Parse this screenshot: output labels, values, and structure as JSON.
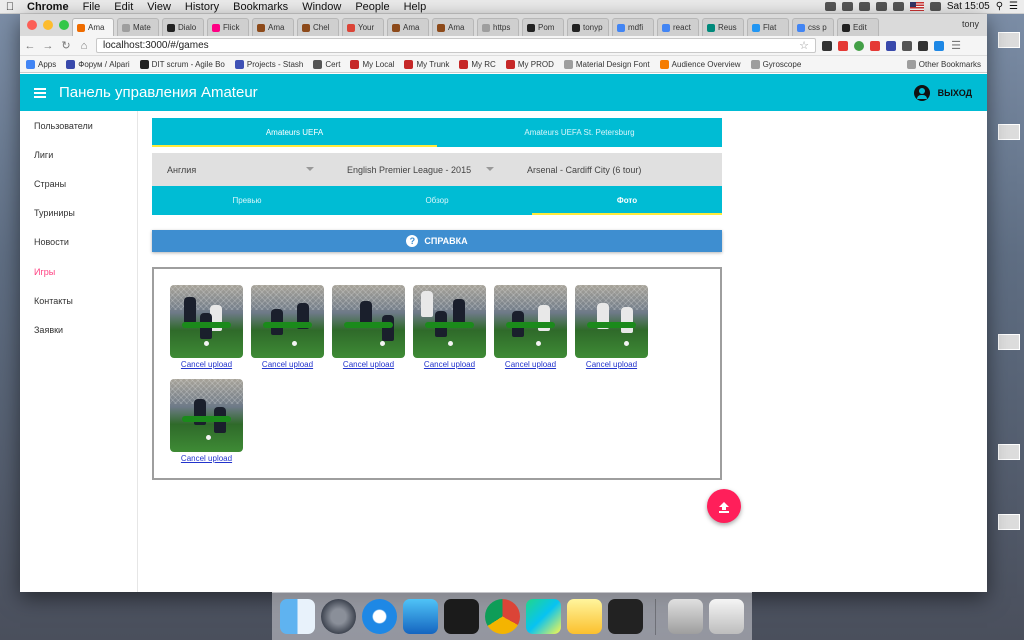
{
  "menubar": {
    "app": "Chrome",
    "items": [
      "File",
      "Edit",
      "View",
      "History",
      "Bookmarks",
      "Window",
      "People",
      "Help"
    ],
    "clock": "Sat 15:05"
  },
  "browser": {
    "tabs": [
      {
        "label": "Ama",
        "color": "#ef6c00",
        "active": true
      },
      {
        "label": "Mate",
        "color": "#9e9e9e"
      },
      {
        "label": "Dialo",
        "color": "#222222"
      },
      {
        "label": "Flick",
        "color": "#ff0084"
      },
      {
        "label": "Ama",
        "color": "#8d4a1a"
      },
      {
        "label": "Chel",
        "color": "#8d4a1a"
      },
      {
        "label": "Your",
        "color": "#db4437"
      },
      {
        "label": "Ama",
        "color": "#8d4a1a"
      },
      {
        "label": "Ama",
        "color": "#8d4a1a"
      },
      {
        "label": "https",
        "color": "#9e9e9e"
      },
      {
        "label": "Pom",
        "color": "#222222"
      },
      {
        "label": "tonyp",
        "color": "#222222"
      },
      {
        "label": "mdfi",
        "color": "#4285f4"
      },
      {
        "label": "react",
        "color": "#4285f4"
      },
      {
        "label": "Reus",
        "color": "#00897b"
      },
      {
        "label": "Flat",
        "color": "#2196f3"
      },
      {
        "label": "css p",
        "color": "#4285f4"
      },
      {
        "label": "Edit",
        "color": "#222222"
      }
    ],
    "profile": "tony",
    "url": "localhost:3000/#/games",
    "bookmarks": [
      {
        "label": "Apps",
        "color": "#4285f4"
      },
      {
        "label": "Форум / Alpari",
        "color": "#3949ab"
      },
      {
        "label": "DIT scrum - Agile Bo",
        "color": "#222222"
      },
      {
        "label": "Projects - Stash",
        "color": "#3f51b5"
      },
      {
        "label": "Cert",
        "color": "#555555"
      },
      {
        "label": "My Local",
        "color": "#c62828"
      },
      {
        "label": "My Trunk",
        "color": "#c62828"
      },
      {
        "label": "My RC",
        "color": "#c62828"
      },
      {
        "label": "My PROD",
        "color": "#c62828"
      },
      {
        "label": "Material Design Font",
        "color": "#9e9e9e"
      },
      {
        "label": "Audience Overview",
        "color": "#f57c00"
      },
      {
        "label": "Gyroscope",
        "color": "#9e9e9e"
      }
    ],
    "other_bookmarks": "Other Bookmarks"
  },
  "app": {
    "title": "Панель управления Amateur",
    "logout": "ВЫХОД",
    "accent": "#00bcd4",
    "sidebar": [
      {
        "label": "Пользователи"
      },
      {
        "label": "Лиги"
      },
      {
        "label": "Страны"
      },
      {
        "label": "Туриниры"
      },
      {
        "label": "Новости"
      },
      {
        "label": "Игры",
        "active": true
      },
      {
        "label": "Контакты"
      },
      {
        "label": "Заявки"
      }
    ],
    "org_tabs": [
      {
        "label": "Amateurs UEFA",
        "active": true
      },
      {
        "label": "Amateurs UEFA St. Petersburg"
      }
    ],
    "selects": {
      "country": "Англия",
      "league": "English Premier League - 2015",
      "game": "Arsenal - Cardiff City (6 tour)"
    },
    "game_tabs": [
      {
        "label": "Превью"
      },
      {
        "label": "Обзор"
      },
      {
        "label": "Фото",
        "active": true
      }
    ],
    "help_button": "СПРАВКА",
    "uploads": [
      {
        "cancel": "Cancel upload",
        "progress": 1.0
      },
      {
        "cancel": "Cancel upload",
        "progress": 1.0
      },
      {
        "cancel": "Cancel upload",
        "progress": 1.0
      },
      {
        "cancel": "Cancel upload",
        "progress": 1.0
      },
      {
        "cancel": "Cancel upload",
        "progress": 1.0
      },
      {
        "cancel": "Cancel upload",
        "progress": 1.0
      },
      {
        "cancel": "Cancel upload",
        "progress": 1.0
      }
    ]
  },
  "dock": {
    "apps": [
      "finder-icon",
      "launchpad-icon",
      "safari-icon",
      "app-store-icon",
      "terminal-icon",
      "chrome-icon",
      "webstorm-icon",
      "notes-icon",
      "activity-monitor-icon",
      "preview-icon",
      "trash-icon"
    ]
  }
}
